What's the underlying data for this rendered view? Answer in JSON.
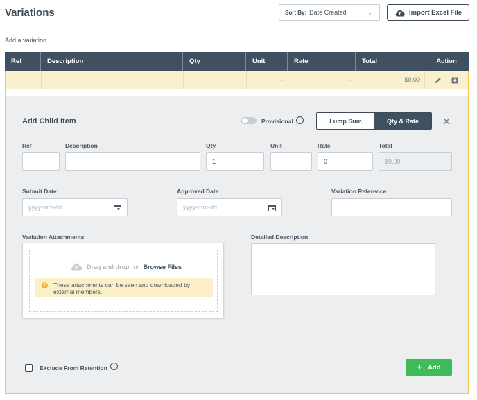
{
  "header": {
    "title": "Variations",
    "sort_label": "Sort By:",
    "sort_value": "Date Created",
    "import_label": "Import Excel File",
    "subtitle": "Add a variation."
  },
  "table": {
    "columns": [
      "Ref",
      "Description",
      "Qty",
      "Unit",
      "Rate",
      "Total",
      "Action"
    ],
    "row": {
      "ref": "",
      "description": "",
      "qty": "–",
      "unit": "–",
      "rate": "–",
      "total": "$0.00"
    }
  },
  "form": {
    "title": "Add Child Item",
    "provisional_label": "Provisional",
    "modes": [
      "Lump Sum",
      "Qty & Rate"
    ],
    "active_mode": "Qty & Rate",
    "ref_label": "Ref",
    "description_label": "Description",
    "qty_label": "Qty",
    "qty_value": "1",
    "unit_label": "Unit",
    "rate_label": "Rate",
    "rate_value": "0",
    "total_label": "Total",
    "total_value": "$0.00",
    "submit_date_label": "Submit Date",
    "submit_date_placeholder": "yyyy-mm-dd",
    "approved_date_label": "Approved Date",
    "approved_date_placeholder": "yyyy-mm-dd",
    "variation_reference_label": "Variation Reference",
    "attachments_label": "Variation Attachments",
    "drag_text": "Drag and drop",
    "or_text": "or",
    "browse_text": "Browse Files",
    "attachments_note": "These attachments can be seen and downloaded by external members.",
    "detailed_description_label": "Detailed Description",
    "exclude_label": "Exclude From Retention",
    "add_label": "Add"
  },
  "colors": {
    "header_bg": "#3f5061",
    "row_highlight": "#fbf0cd",
    "accent_border": "#f2c94c",
    "add_button": "#3fbb5a"
  }
}
